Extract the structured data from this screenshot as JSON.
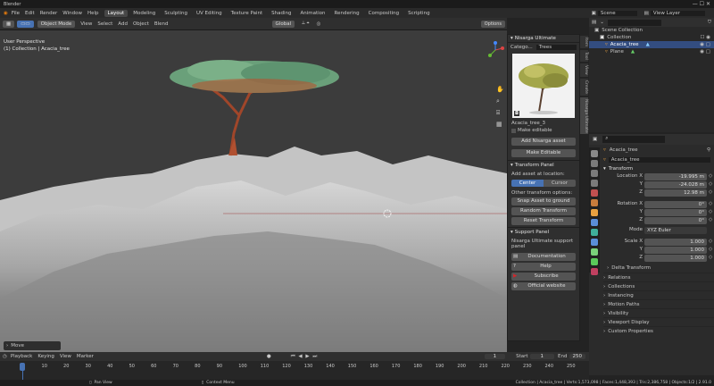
{
  "app": {
    "title": "Blender"
  },
  "menu": [
    "File",
    "Edit",
    "Render",
    "Window",
    "Help"
  ],
  "workspaces": [
    "Layout",
    "Modeling",
    "Sculpting",
    "UV Editing",
    "Texture Paint",
    "Shading",
    "Animation",
    "Rendering",
    "Compositing",
    "Scripting"
  ],
  "topright": {
    "scene": "Scene",
    "view_layer": "View Layer"
  },
  "viewport": {
    "mode": "Object Mode",
    "menus": [
      "View",
      "Select",
      "Add",
      "Object",
      "Blend"
    ],
    "transform_orientation": "Global",
    "options": "Options",
    "overlay_title": "User Perspective",
    "overlay_sub": "(1) Collection | Acacia_tree",
    "last_op": "Move"
  },
  "npanel": {
    "title": "Nisarga Ultimate",
    "category_label": "Catego...",
    "category_value": "Trees",
    "asset_name": "Acacia_tree_3",
    "make_editable_check": "Make editable",
    "add_asset": "Add Nisarga asset",
    "make_editable": "Make Editable",
    "transform_panel": "Transform Panel",
    "add_location_label": "Add asset at location:",
    "center": "Center",
    "cursor": "Cursor",
    "other_transform": "Other transform options:",
    "snap": "Snap Asset to ground",
    "random": "Random Transform",
    "reset": "Reset Transform",
    "support_panel": "Support Panel",
    "support_text": "Nisarga Ultimate support panel",
    "documentation": "Documentation",
    "help": "Help",
    "subscribe": "Subscribe",
    "website": "Official website"
  },
  "side_tabs": [
    "Item",
    "Tool",
    "View",
    "Create",
    "Nisarga Ultimate"
  ],
  "outliner": {
    "root": "Scene Collection",
    "items": [
      {
        "label": "Collection"
      },
      {
        "label": "Acacia_tree"
      },
      {
        "label": "Plane"
      }
    ]
  },
  "properties": {
    "object_name": "Acacia_tree",
    "object_field": "Acacia_tree",
    "transform_header": "Transform",
    "location_label": "Location X",
    "location": [
      "-19.995 m",
      "-24.028 m",
      "12.98 m"
    ],
    "rotation_label": "Rotation X",
    "rotation": [
      "0°",
      "0°",
      "0°"
    ],
    "mode_label": "Mode",
    "mode_value": "XYZ Euler",
    "scale_label": "Scale X",
    "scale": [
      "1.000",
      "1.000",
      "1.000"
    ],
    "axis_labels": [
      "Y",
      "Z"
    ],
    "delta": "Delta Transform",
    "sections": [
      "Relations",
      "Collections",
      "Instancing",
      "Motion Paths",
      "Visibility",
      "Viewport Display",
      "Custom Properties"
    ]
  },
  "timeline": {
    "menus": [
      "Playback",
      "Keying",
      "View",
      "Marker"
    ],
    "current_frame": "1",
    "start_label": "Start",
    "start": "1",
    "end_label": "End",
    "end": "250",
    "ticks": [
      "1",
      "10",
      "20",
      "30",
      "40",
      "50",
      "60",
      "70",
      "80",
      "90",
      "100",
      "110",
      "120",
      "130",
      "140",
      "150",
      "160",
      "170",
      "180",
      "190",
      "200",
      "210",
      "220",
      "230",
      "240",
      "250"
    ]
  },
  "status": {
    "pan_view": "Pan View",
    "context_menu": "Context Menu",
    "stats": "Collection | Acacia_tree | Verts:1,573,098 | Faces:1,448,393 | Tris:2,386,758 | Objects:1/2 | 2.91.0"
  },
  "colors": {
    "accent": "#4772b3",
    "selected_row": "#334d80",
    "subscribe": "#d4262b"
  }
}
